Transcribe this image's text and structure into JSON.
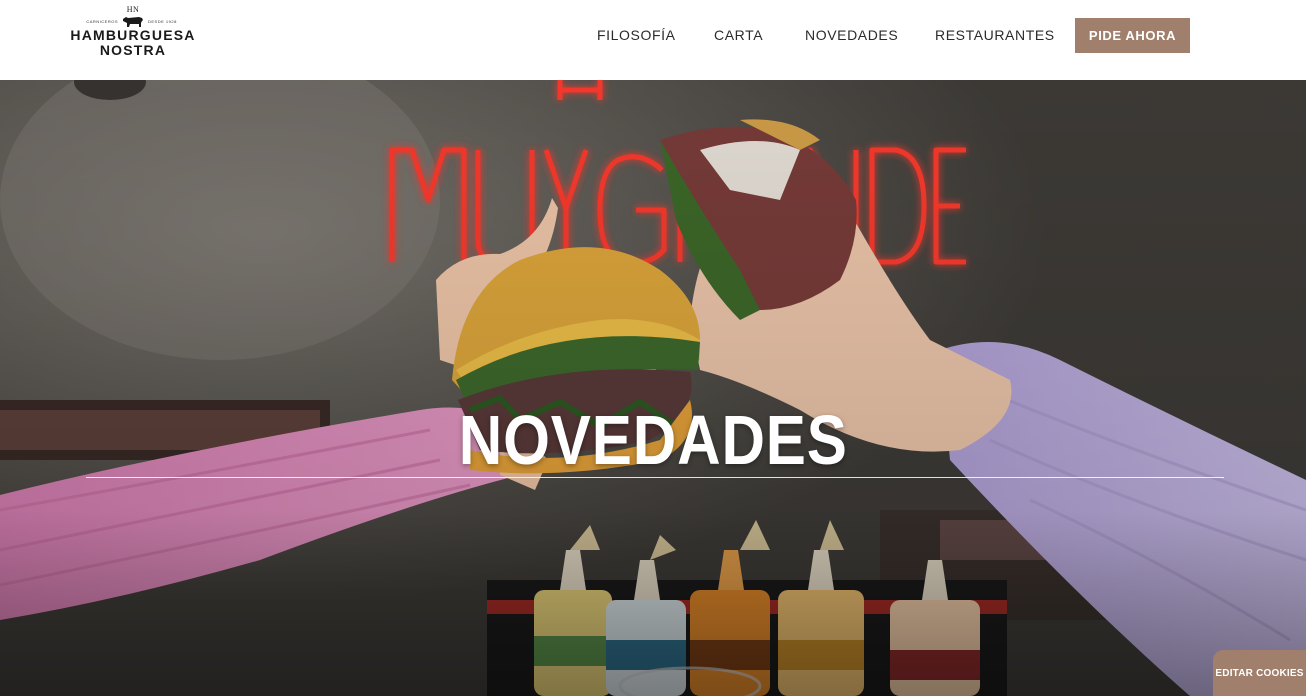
{
  "brand": {
    "monogram": "HN",
    "tagline_left": "CARNICEROS",
    "tagline_right": "DESDE 1928",
    "name_line1": "HAMBURGUESA",
    "name_line2": "NOSTRA"
  },
  "nav": {
    "items": [
      {
        "label": "FILOSOFÍA"
      },
      {
        "label": "CARTA"
      },
      {
        "label": "NOVEDADES"
      },
      {
        "label": "RESTAURANTES"
      }
    ],
    "cta_label": "PIDE AHORA"
  },
  "hero": {
    "title": "NOVEDADES",
    "neon_text": "MUY GRANDE"
  },
  "cookies": {
    "label": "EDITAR COOKIES"
  },
  "colors": {
    "accent": "#a07f6c",
    "text_dark": "#2b2b2b",
    "neon": "#ff3a2e"
  }
}
